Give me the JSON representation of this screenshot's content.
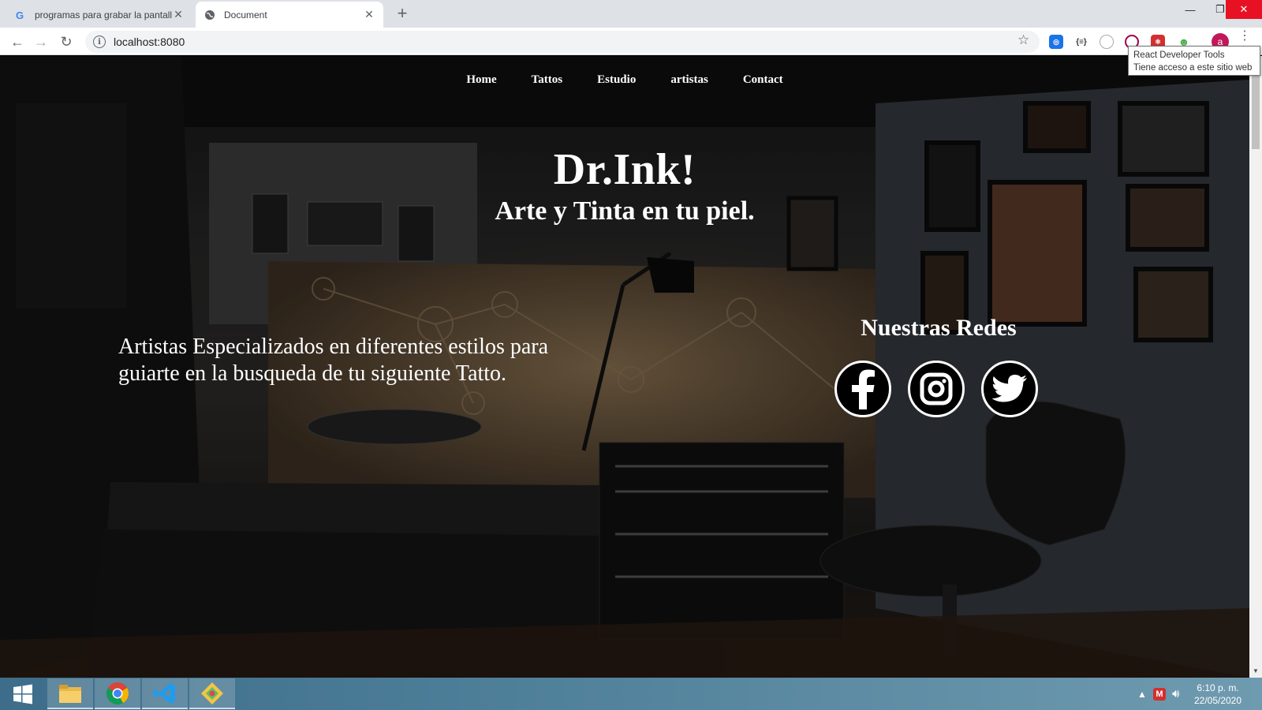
{
  "browser": {
    "tabs": [
      {
        "title": "programas para grabar la pantall",
        "active": false,
        "favicon": "google-icon"
      },
      {
        "title": "Document",
        "active": true,
        "favicon": "globe-icon"
      }
    ],
    "address": "localhost:8080",
    "tooltip": {
      "line1": "React Developer Tools",
      "line2": "Tiene acceso a este sitio web"
    },
    "profile_initial": "a"
  },
  "page": {
    "nav": [
      "Home",
      "Tattos",
      "Estudio",
      "artistas",
      "Contact"
    ],
    "title": "Dr.Ink!",
    "subtitle": "Arte y Tinta en tu piel.",
    "blurb": "Artistas Especializados en diferentes estilos para guiarte en la busqueda de tu siguiente Tatto.",
    "social_title": "Nuestras Redes",
    "social": [
      "facebook-icon",
      "instagram-icon",
      "twitter-icon"
    ]
  },
  "taskbar": {
    "time": "6:10 p. m.",
    "date": "22/05/2020"
  }
}
